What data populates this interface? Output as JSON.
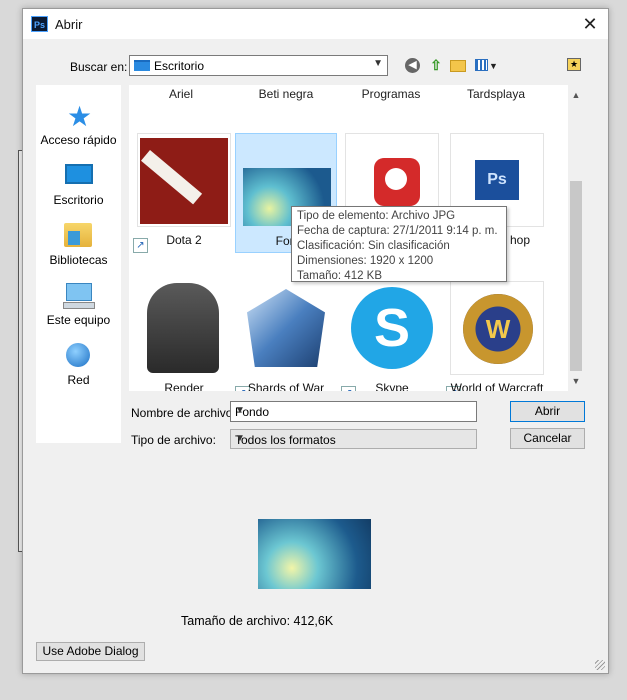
{
  "window": {
    "title": "Abrir",
    "app_icon": "Ps",
    "close_glyph": "✕"
  },
  "lookin": {
    "label": "Buscar en:",
    "value": "Escritorio"
  },
  "places": [
    {
      "label": "Acceso rápido",
      "icon": "star-icon"
    },
    {
      "label": "Escritorio",
      "icon": "desktop-icon"
    },
    {
      "label": "Bibliotecas",
      "icon": "libraries-icon"
    },
    {
      "label": "Este equipo",
      "icon": "computer-icon"
    },
    {
      "label": "Red",
      "icon": "network-icon"
    }
  ],
  "files": {
    "top_row": [
      "Ariel",
      "Beti negra",
      "Programas",
      "Tardsplaya"
    ],
    "row1": [
      "Dota 2",
      "Fondo",
      "",
      "Photoshop"
    ],
    "row1_visible": [
      "Dota 2",
      "Fon",
      "",
      "hop"
    ],
    "row2": [
      "Render",
      "Shards of War",
      "Skype",
      "World of Warcraft"
    ]
  },
  "tooltip": {
    "type": "Tipo de elemento: Archivo JPG",
    "date": "Fecha de captura: 27/1/2011 9:14 p. m.",
    "rating": "Clasificación: Sin clasificación",
    "dimensions": "Dimensiones: 1920 x 1200",
    "size": "Tamaño: 412 KB"
  },
  "form": {
    "filename_label": "Nombre de archivo:",
    "filename_value": "Fondo",
    "filetype_label": "Tipo de archivo:",
    "filetype_value": "Todos los formatos"
  },
  "buttons": {
    "open": "Abrir",
    "cancel": "Cancelar",
    "adobe": "Use Adobe Dialog"
  },
  "preview": {
    "filesize": "Tamaño de archivo: 412,6K"
  }
}
